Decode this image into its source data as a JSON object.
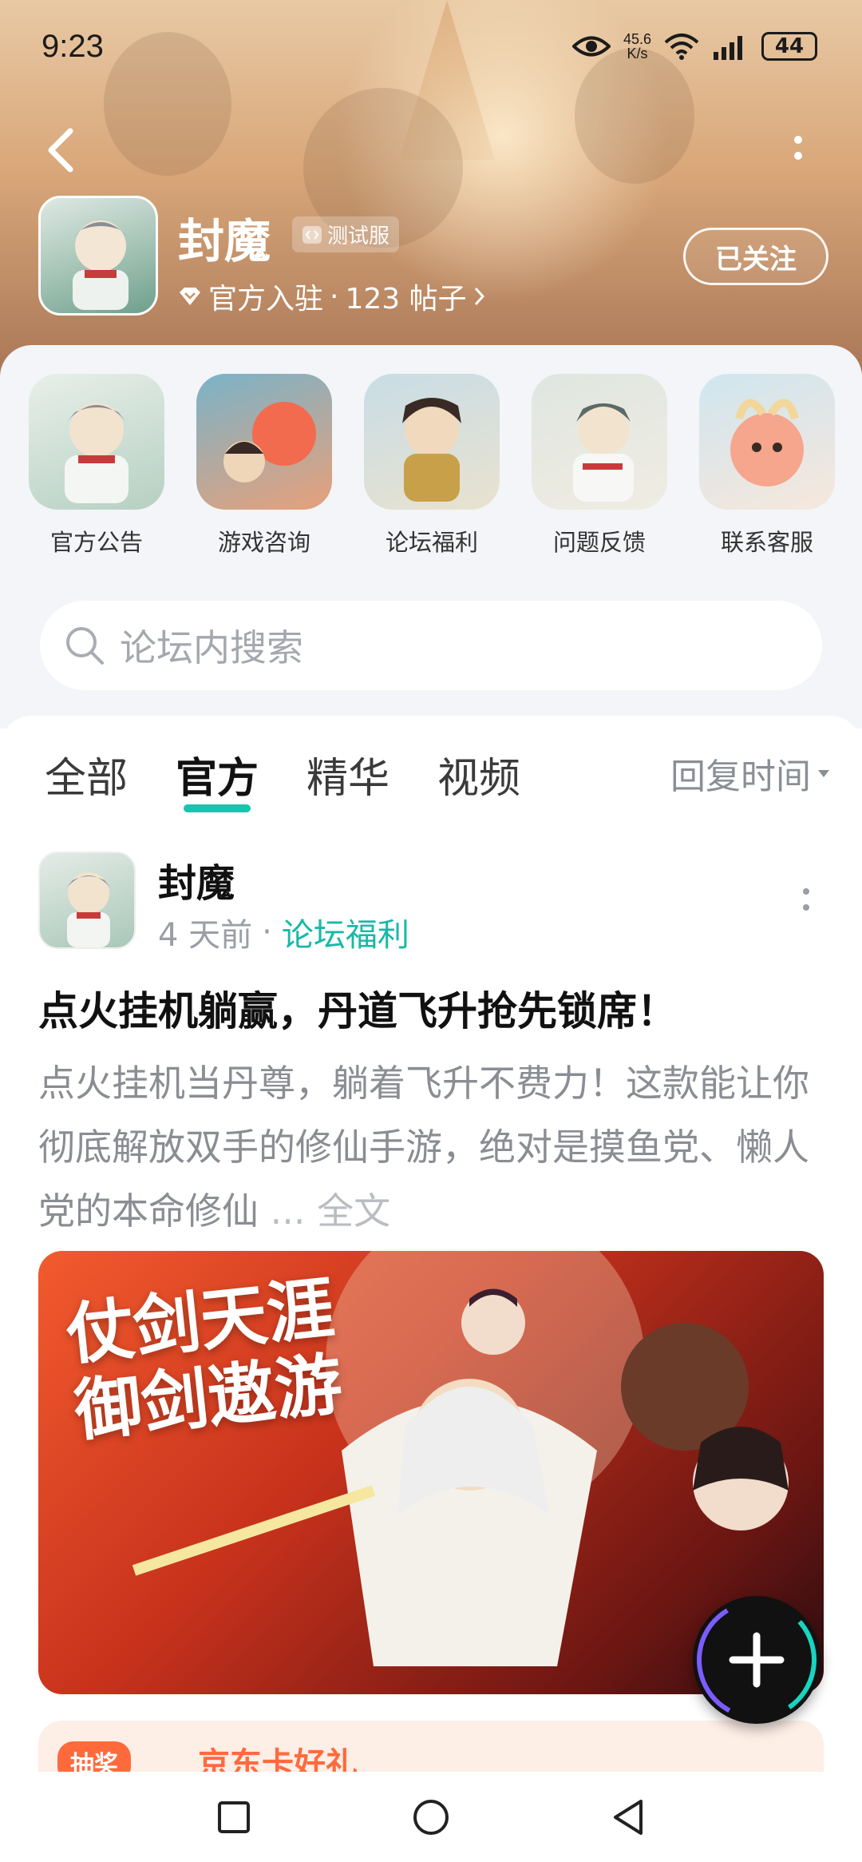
{
  "status_bar": {
    "time": "9:23",
    "net_speed_value": "45.6",
    "net_speed_unit": "K/s",
    "battery": "44"
  },
  "forum": {
    "name": "封魔",
    "tag": "测试服",
    "meta_prefix": "官方入驻",
    "meta_posts": "123 帖子",
    "follow_label": "已关注"
  },
  "shortcuts": [
    {
      "label": "官方公告"
    },
    {
      "label": "游戏咨询"
    },
    {
      "label": "论坛福利"
    },
    {
      "label": "问题反馈"
    },
    {
      "label": "联系客服"
    }
  ],
  "search": {
    "placeholder": "论坛内搜索"
  },
  "tabs": [
    {
      "label": "全部",
      "active": false
    },
    {
      "label": "官方",
      "active": true
    },
    {
      "label": "精华",
      "active": false
    },
    {
      "label": "视频",
      "active": false
    }
  ],
  "sort_label": "回复时间",
  "post": {
    "author": "封魔",
    "time": "4 天前",
    "category": "论坛福利",
    "title": "点火挂机躺赢，丹道飞升抢先锁席！",
    "body": "点火挂机当丹尊，躺着飞升不费力！这款能让你彻底解放双手的修仙手游，绝对是摸鱼党、懒人党的本命修仙",
    "more": "... 全文",
    "image_text_line1": "仗剑天涯",
    "image_text_line2": "御剑遨游"
  },
  "next_card": {
    "tag": "抽奖",
    "text": "京东卡好礼"
  },
  "colors": {
    "accent": "#17c4b0",
    "panel_bg": "#f3f5f8"
  }
}
